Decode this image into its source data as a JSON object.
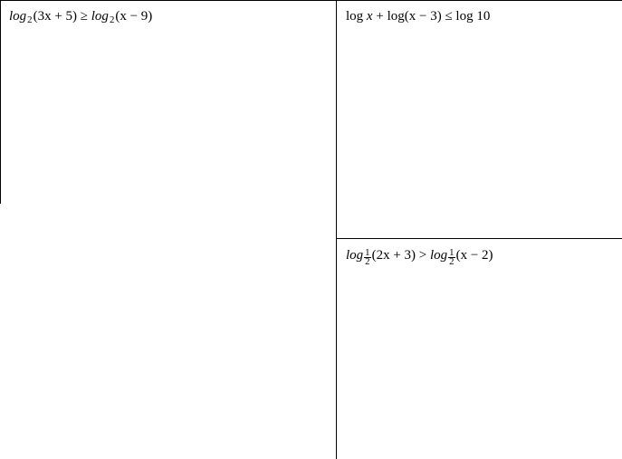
{
  "problems": {
    "a": {
      "fn": "log",
      "base": "2",
      "lhs_arg": "(3x + 5)",
      "op": "≥",
      "rhs_fn": "log",
      "rhs_base": "2",
      "rhs_arg": "(x − 9)"
    },
    "b": {
      "t1_fn": "log",
      "t1_arg": "x",
      "plus": "+",
      "t2_fn": "log",
      "t2_arg": "(x − 3)",
      "op": "≤",
      "rhs_fn": "log",
      "rhs_arg": "10"
    },
    "c": {
      "fn": "log",
      "base_num": "1",
      "base_den": "2",
      "lhs_arg": "(2x + 3)",
      "op": ">",
      "rhs_fn": "log",
      "rhs_base_num": "1",
      "rhs_base_den": "2",
      "rhs_arg": "(x − 2)"
    }
  }
}
